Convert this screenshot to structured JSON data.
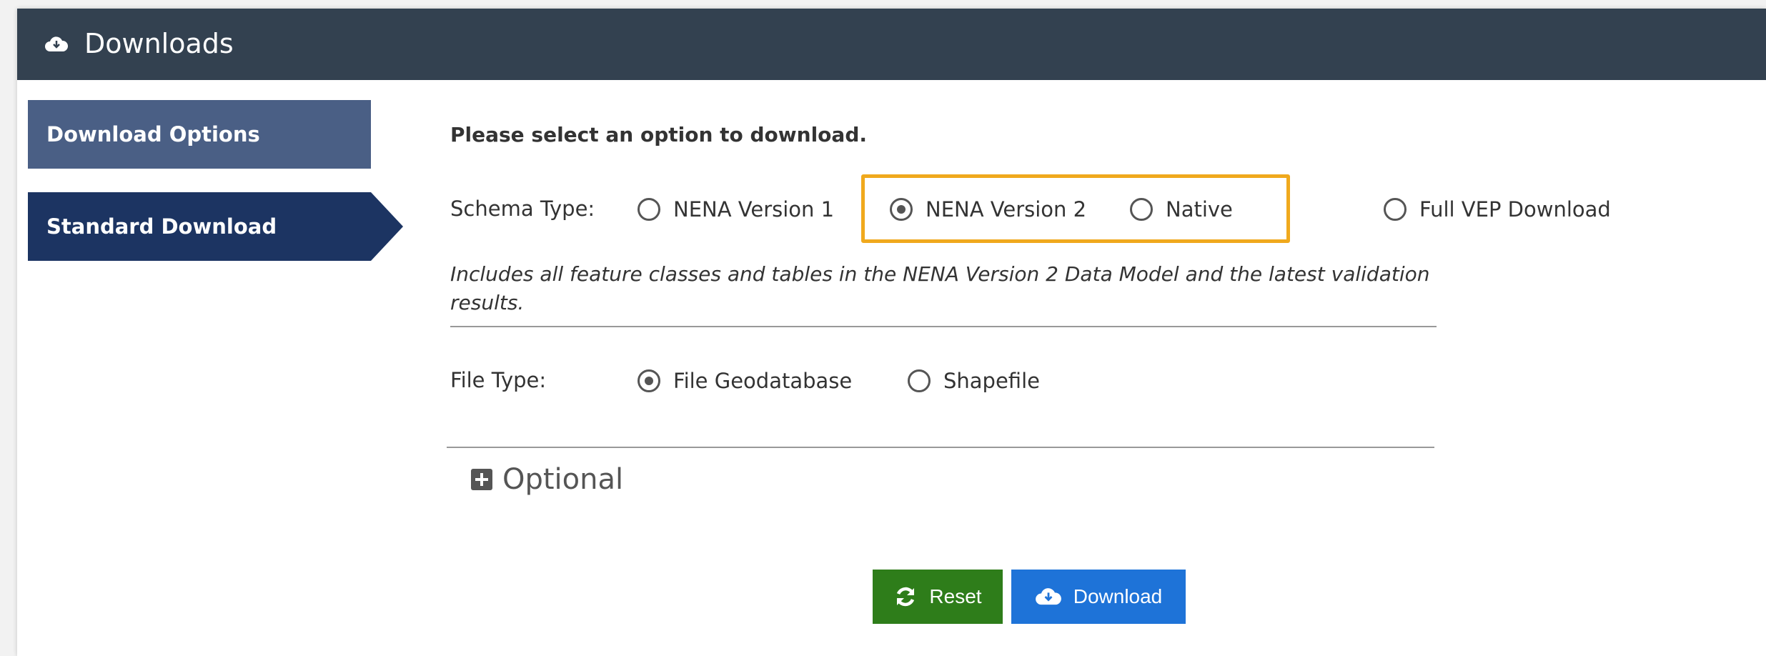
{
  "header": {
    "title": "Downloads",
    "icon": "cloud-download-icon"
  },
  "sidebar": {
    "items": [
      {
        "label": "Download Options",
        "active": false
      },
      {
        "label": "Standard Download",
        "active": true
      }
    ]
  },
  "main": {
    "prompt": "Please select an option to download.",
    "schema": {
      "label": "Schema Type:",
      "options": [
        {
          "label": "NENA Version 1",
          "checked": false
        },
        {
          "label": "NENA Version 2",
          "checked": true
        },
        {
          "label": "Native",
          "checked": false
        },
        {
          "label": "Full VEP Download",
          "checked": false
        }
      ],
      "description": "Includes all feature classes and tables in the NENA Version 2 Data Model and the latest validation results."
    },
    "file_type": {
      "label": "File Type:",
      "options": [
        {
          "label": "File Geodatabase",
          "checked": true
        },
        {
          "label": "Shapefile",
          "checked": false
        }
      ]
    },
    "optional": {
      "label": "Optional",
      "icon": "plus-square-icon"
    },
    "buttons": {
      "reset": "Reset",
      "download": "Download"
    }
  },
  "colors": {
    "header_bg": "#334150",
    "sidebar_inactive": "#4a5f85",
    "sidebar_active": "#1c3462",
    "highlight": "#f0a91d",
    "reset_btn": "#2e7d1a",
    "download_btn": "#1e73d8"
  }
}
